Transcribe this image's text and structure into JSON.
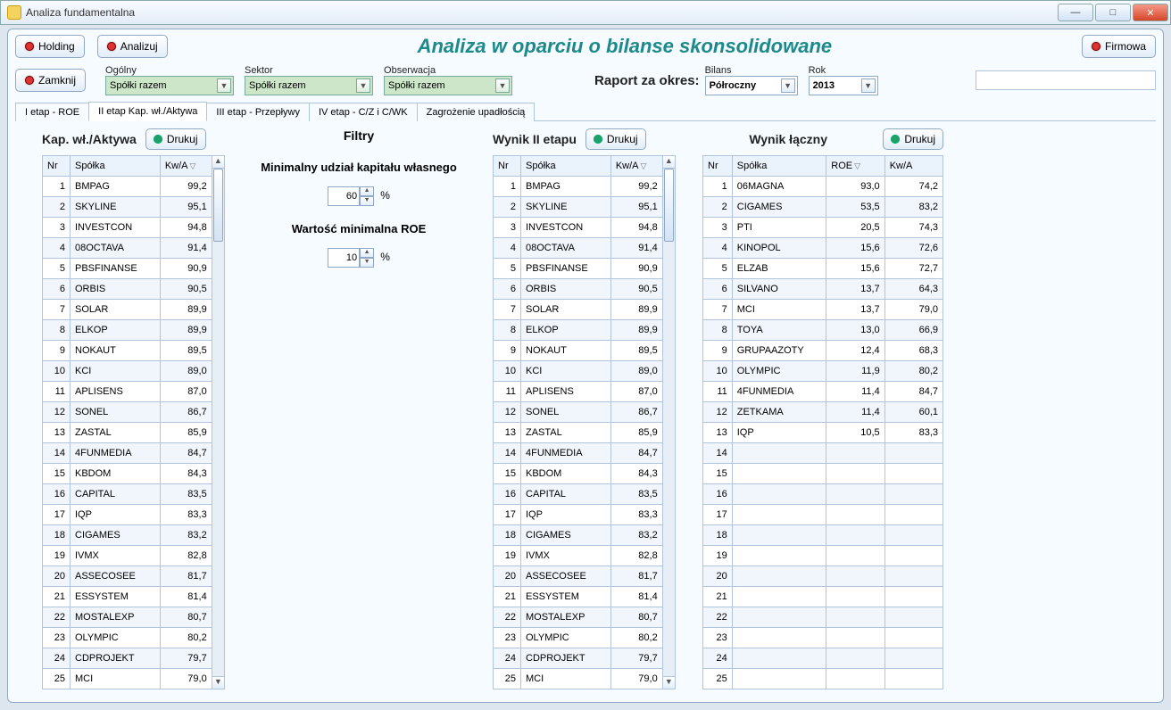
{
  "window": {
    "title": "Analiza fundamentalna"
  },
  "buttons": {
    "holding": "Holding",
    "analizuj": "Analizuj",
    "firmowa": "Firmowa",
    "zamknij": "Zamknij",
    "drukuj": "Drukuj"
  },
  "headline": "Analiza w oparciu o bilanse skonsolidowane",
  "selectors": {
    "ogolny_lbl": "Ogólny",
    "sektor_lbl": "Sektor",
    "obserwacja_lbl": "Obserwacja",
    "ogolny_val": "Spółki razem",
    "sektor_val": "Spółki razem",
    "obserwacja_val": "Spółki razem",
    "raport_lbl": "Raport za okres:",
    "bilans_lbl": "Bilans",
    "rok_lbl": "Rok",
    "bilans_val": "Półroczny",
    "rok_val": "2013"
  },
  "tabs": [
    "I etap - ROE",
    "II etap Kap. wł./Aktywa",
    "III etap - Przepływy",
    "IV etap - C/Z i C/WK",
    "Zagrożenie upadłością"
  ],
  "active_tab": 1,
  "filters": {
    "title": "Filtry",
    "lbl1": "Minimalny udział kapitału własnego",
    "val1": "60",
    "lbl2": "Wartość minimalna ROE",
    "val2": "10",
    "pct": "%"
  },
  "tables": {
    "t1": {
      "title": "Kap. wł./Aktywa",
      "cols": [
        "Nr",
        "Spółka",
        "Kw/A"
      ],
      "rows": [
        [
          "1",
          "BMPAG",
          "99,2"
        ],
        [
          "2",
          "SKYLINE",
          "95,1"
        ],
        [
          "3",
          "INVESTCON",
          "94,8"
        ],
        [
          "4",
          "08OCTAVA",
          "91,4"
        ],
        [
          "5",
          "PBSFINANSE",
          "90,9"
        ],
        [
          "6",
          "ORBIS",
          "90,5"
        ],
        [
          "7",
          "SOLAR",
          "89,9"
        ],
        [
          "8",
          "ELKOP",
          "89,9"
        ],
        [
          "9",
          "NOKAUT",
          "89,5"
        ],
        [
          "10",
          "KCI",
          "89,0"
        ],
        [
          "11",
          "APLISENS",
          "87,0"
        ],
        [
          "12",
          "SONEL",
          "86,7"
        ],
        [
          "13",
          "ZASTAL",
          "85,9"
        ],
        [
          "14",
          "4FUNMEDIA",
          "84,7"
        ],
        [
          "15",
          "KBDOM",
          "84,3"
        ],
        [
          "16",
          "CAPITAL",
          "83,5"
        ],
        [
          "17",
          "IQP",
          "83,3"
        ],
        [
          "18",
          "CIGAMES",
          "83,2"
        ],
        [
          "19",
          "IVMX",
          "82,8"
        ],
        [
          "20",
          "ASSECOSEE",
          "81,7"
        ],
        [
          "21",
          "ESSYSTEM",
          "81,4"
        ],
        [
          "22",
          "MOSTALEXP",
          "80,7"
        ],
        [
          "23",
          "OLYMPIC",
          "80,2"
        ],
        [
          "24",
          "CDPROJEKT",
          "79,7"
        ],
        [
          "25",
          "MCI",
          "79,0"
        ]
      ]
    },
    "t2": {
      "title": "Wynik II etapu",
      "cols": [
        "Nr",
        "Spółka",
        "Kw/A"
      ],
      "rows": [
        [
          "1",
          "BMPAG",
          "99,2"
        ],
        [
          "2",
          "SKYLINE",
          "95,1"
        ],
        [
          "3",
          "INVESTCON",
          "94,8"
        ],
        [
          "4",
          "08OCTAVA",
          "91,4"
        ],
        [
          "5",
          "PBSFINANSE",
          "90,9"
        ],
        [
          "6",
          "ORBIS",
          "90,5"
        ],
        [
          "7",
          "SOLAR",
          "89,9"
        ],
        [
          "8",
          "ELKOP",
          "89,9"
        ],
        [
          "9",
          "NOKAUT",
          "89,5"
        ],
        [
          "10",
          "KCI",
          "89,0"
        ],
        [
          "11",
          "APLISENS",
          "87,0"
        ],
        [
          "12",
          "SONEL",
          "86,7"
        ],
        [
          "13",
          "ZASTAL",
          "85,9"
        ],
        [
          "14",
          "4FUNMEDIA",
          "84,7"
        ],
        [
          "15",
          "KBDOM",
          "84,3"
        ],
        [
          "16",
          "CAPITAL",
          "83,5"
        ],
        [
          "17",
          "IQP",
          "83,3"
        ],
        [
          "18",
          "CIGAMES",
          "83,2"
        ],
        [
          "19",
          "IVMX",
          "82,8"
        ],
        [
          "20",
          "ASSECOSEE",
          "81,7"
        ],
        [
          "21",
          "ESSYSTEM",
          "81,4"
        ],
        [
          "22",
          "MOSTALEXP",
          "80,7"
        ],
        [
          "23",
          "OLYMPIC",
          "80,2"
        ],
        [
          "24",
          "CDPROJEKT",
          "79,7"
        ],
        [
          "25",
          "MCI",
          "79,0"
        ]
      ]
    },
    "t3": {
      "title": "Wynik łączny",
      "cols": [
        "Nr",
        "Spółka",
        "ROE",
        "Kw/A"
      ],
      "rows": [
        [
          "1",
          "06MAGNA",
          "93,0",
          "74,2"
        ],
        [
          "2",
          "CIGAMES",
          "53,5",
          "83,2"
        ],
        [
          "3",
          "PTI",
          "20,5",
          "74,3"
        ],
        [
          "4",
          "KINOPOL",
          "15,6",
          "72,6"
        ],
        [
          "5",
          "ELZAB",
          "15,6",
          "72,7"
        ],
        [
          "6",
          "SILVANO",
          "13,7",
          "64,3"
        ],
        [
          "7",
          "MCI",
          "13,7",
          "79,0"
        ],
        [
          "8",
          "TOYA",
          "13,0",
          "66,9"
        ],
        [
          "9",
          "GRUPAAZOTY",
          "12,4",
          "68,3"
        ],
        [
          "10",
          "OLYMPIC",
          "11,9",
          "80,2"
        ],
        [
          "11",
          "4FUNMEDIA",
          "11,4",
          "84,7"
        ],
        [
          "12",
          "ZETKAMA",
          "11,4",
          "60,1"
        ],
        [
          "13",
          "IQP",
          "10,5",
          "83,3"
        ],
        [
          "14",
          "",
          "",
          ""
        ],
        [
          "15",
          "",
          "",
          ""
        ],
        [
          "16",
          "",
          "",
          ""
        ],
        [
          "17",
          "",
          "",
          ""
        ],
        [
          "18",
          "",
          "",
          ""
        ],
        [
          "19",
          "",
          "",
          ""
        ],
        [
          "20",
          "",
          "",
          ""
        ],
        [
          "21",
          "",
          "",
          ""
        ],
        [
          "22",
          "",
          "",
          ""
        ],
        [
          "23",
          "",
          "",
          ""
        ],
        [
          "24",
          "",
          "",
          ""
        ],
        [
          "25",
          "",
          "",
          ""
        ]
      ]
    }
  }
}
